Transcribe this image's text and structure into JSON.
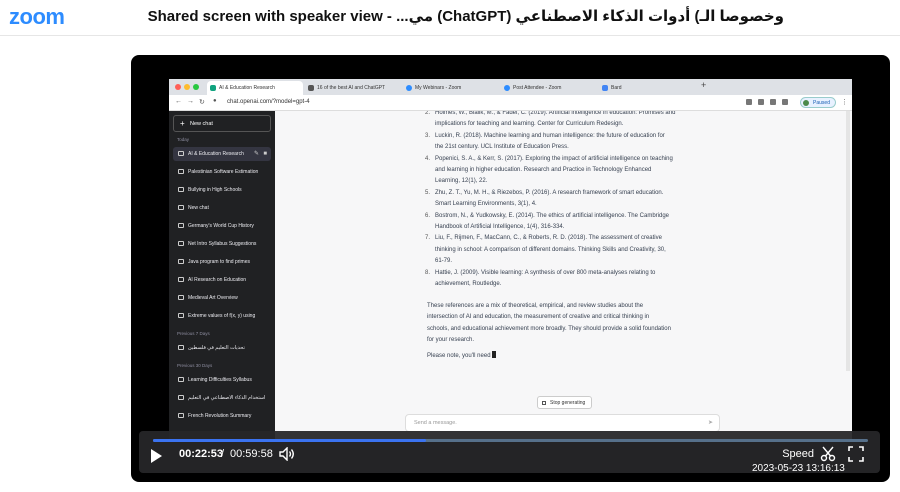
{
  "header": {
    "logo": "zoom",
    "title": "Shared screen with speaker view - ...مي (ChatGPT) وخصوصا الـ) أدوات الذكاء الاصطناعي"
  },
  "browser": {
    "tabs": [
      {
        "label": "AI & Education Research"
      },
      {
        "label": "16 of the best AI and ChatGPT"
      },
      {
        "label": "My Webinars - Zoom"
      },
      {
        "label": "Post Attendee - Zoom"
      },
      {
        "label": "Bard"
      }
    ],
    "url": "chat.openai.com/?model=gpt-4",
    "paused_label": "Paused"
  },
  "sidebar": {
    "new_chat": "New chat",
    "sections": {
      "today": "Today",
      "previous_7": "Previous 7 Days",
      "previous_30": "Previous 30 Days"
    },
    "today_items": [
      "AI & Education Research",
      "Palestinian Software Estimation",
      "Bullying in High Schools",
      "New chat",
      "Germany's World Cup History",
      "Net Intro Syllabus Suggestions",
      "Java program to find primes",
      "AI Research on Education",
      "Medieval Art Overview",
      "Extreme values of f(x, y) using"
    ],
    "prev7_items": [
      "تحديات التعليم في فلسطين"
    ],
    "prev30_items": [
      "Learning Difficulties Syllabus",
      "استخدام الذكاء الاصطناعي في التعليم",
      "French Revolution Summary"
    ]
  },
  "chat": {
    "references": [
      {
        "num": "2.",
        "lines": [
          "Holmes, W., Bialik, M., & Fadel, C. (2019). Artificial intelligence in education: Promises and",
          "implications for teaching and learning. Center for Curriculum Redesign."
        ]
      },
      {
        "num": "3.",
        "lines": [
          "Luckin, R. (2018). Machine learning and human intelligence: the future of education for",
          "the 21st century. UCL Institute of Education Press."
        ]
      },
      {
        "num": "4.",
        "lines": [
          "Popenici, S. A., & Kerr, S. (2017). Exploring the impact of artificial intelligence on teaching",
          "and learning in higher education. Research and Practice in Technology Enhanced",
          "Learning, 12(1), 22."
        ]
      },
      {
        "num": "5.",
        "lines": [
          "Zhu, Z. T., Yu, M. H., & Riezebos, P. (2016). A research framework of smart education.",
          "Smart Learning Environments, 3(1), 4."
        ]
      },
      {
        "num": "6.",
        "lines": [
          "Bostrom, N., & Yudkowsky, E. (2014). The ethics of artificial intelligence. The Cambridge",
          "Handbook of Artificial Intelligence, 1(4), 316-334."
        ]
      },
      {
        "num": "7.",
        "lines": [
          "Liu, F., Rijmen, F., MacCann, C., & Roberts, R. D. (2018). The assessment of creative",
          "thinking in school: A comparison of different domains. Thinking Skills and Creativity, 30,",
          "61-79."
        ]
      },
      {
        "num": "8.",
        "lines": [
          "Hattie, J. (2009). Visible learning: A synthesis of over 800 meta-analyses relating to",
          "achievement, Routledge."
        ]
      }
    ],
    "summary_lines": [
      "These references are a mix of theoretical, empirical, and review studies about the",
      "intersection of AI and education, the measurement of creative and critical thinking in",
      "schools, and educational achievement more broadly. They should provide a solid foundation",
      "for your research."
    ],
    "partial_line": "Please note, you'll need",
    "stop_label": "Stop generating",
    "input_placeholder": "Send a message."
  },
  "player": {
    "current_time": "00:22:53",
    "separator": "/",
    "total_time": "00:59:58",
    "progress": 0.3817,
    "speed_label": "Speed",
    "timestamp": "2023-05-23 13:16:13"
  },
  "colors": {
    "zoom_blue": "#2d8cff",
    "progress_blue": "#3b73f0",
    "sidebar_bg": "#202123"
  }
}
